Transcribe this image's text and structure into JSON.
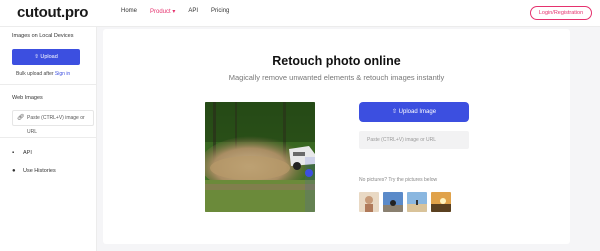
{
  "header": {
    "logo": "cutout.pro",
    "nav": [
      {
        "label": "Home",
        "active": false
      },
      {
        "label": "Product ▾",
        "active": true
      },
      {
        "label": "API",
        "active": false
      },
      {
        "label": "Pricing",
        "active": false
      }
    ],
    "login_label": "Login/Registration"
  },
  "sidebar": {
    "local_heading": "Images on Local Devices",
    "upload_label": "Upload",
    "bulk_text": "Bulk upload after ",
    "bulk_link": "Sign in",
    "web_heading": "Web Images",
    "paste_text": "Paste (CTRL+V) image or URL",
    "api_label": "API",
    "history_label": "Use Histories"
  },
  "main": {
    "title": "Retouch photo online",
    "subtitle": "Magically remove unwanted elements & retouch images instantly",
    "upload_label": "Upload Image",
    "paste_placeholder": "Paste (CTRL+V) image or URL",
    "try_label": "No pictures? Try the pictures below"
  },
  "colors": {
    "accent": "#3c4fe0",
    "brand_pink": "#e5326e"
  }
}
